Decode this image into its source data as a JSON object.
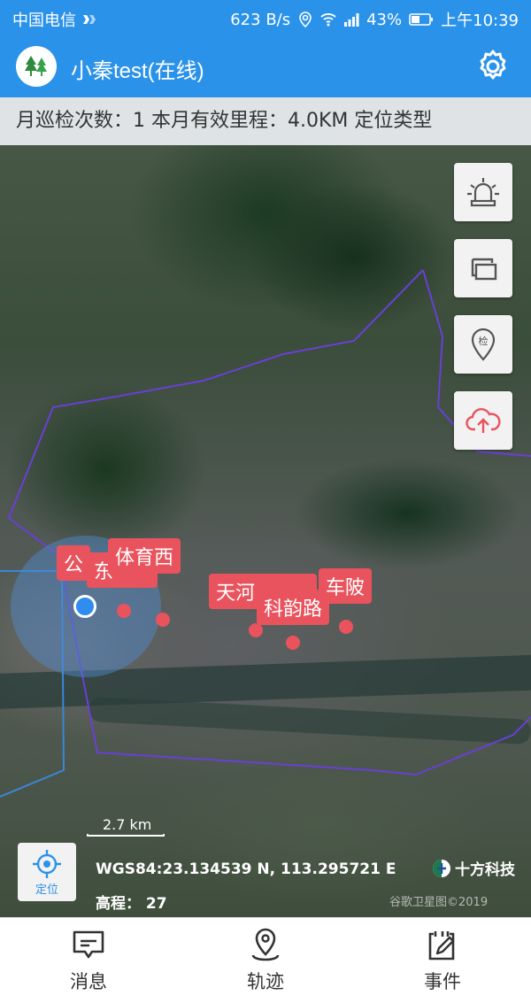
{
  "status_bar": {
    "carrier": "中国电信",
    "speed": "623 B/s",
    "battery": "43%",
    "time": "上午10:39"
  },
  "app_bar": {
    "title": "小秦test(在线)",
    "logo_icon": "tree-logo-icon",
    "settings_icon": "gear-icon"
  },
  "notice": {
    "text": "月巡检次数：1 本月有效里程：4.0KM 定位类型"
  },
  "side_buttons": [
    {
      "icon": "alarm-light-icon"
    },
    {
      "icon": "layers-icon"
    },
    {
      "icon": "inspect-pin-icon",
      "label": "检"
    },
    {
      "icon": "cloud-upload-icon"
    }
  ],
  "markers": [
    {
      "label": "公"
    },
    {
      "label": "东"
    },
    {
      "label": "体育西"
    },
    {
      "label": "天河"
    },
    {
      "label": "科韵路"
    },
    {
      "label": "车陂"
    }
  ],
  "locate_button": {
    "label": "定位",
    "icon": "crosshair-icon"
  },
  "scale": {
    "text": "2.7 km"
  },
  "coords": {
    "text": "WGS84:23.134539 N, 113.295721 E"
  },
  "altitude": {
    "text": "高程：  27"
  },
  "brand": {
    "text": "十方科技"
  },
  "copyright": {
    "text": "谷歌卫星图©2019"
  },
  "bottom_nav": [
    {
      "label": "消息",
      "icon": "message-icon"
    },
    {
      "label": "轨迹",
      "icon": "location-track-icon"
    },
    {
      "label": "事件",
      "icon": "event-edit-icon"
    }
  ],
  "colors": {
    "primary": "#2b92ea",
    "marker": "#e9535d",
    "alert": "#e9535d",
    "boundary": "#6a3fd6"
  }
}
